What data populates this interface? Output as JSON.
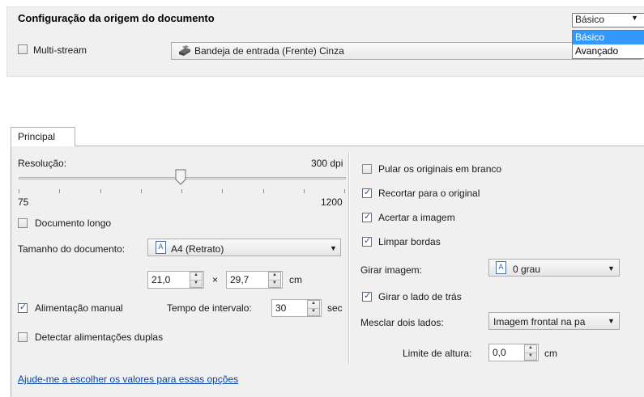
{
  "source": {
    "title": "Configuração da origem do documento",
    "multistream_label": "Multi-stream",
    "multistream_checked": false,
    "source_value": "Bandeja de entrada (Frente) Cinza",
    "mode_selected": "Básico",
    "mode_options": [
      "Básico",
      "Avançado"
    ]
  },
  "tabs": [
    {
      "label": "Principal"
    }
  ],
  "left": {
    "resolution_label": "Resolução:",
    "resolution_value": "300 dpi",
    "slider_min": "75",
    "slider_max": "1200",
    "long_doc_label": "Documento longo",
    "long_doc_checked": false,
    "doc_size_label": "Tamanho do documento:",
    "doc_size_value": "A4 (Retrato)",
    "width_value": "21,0",
    "times_symbol": "×",
    "height_value": "29,7",
    "unit_cm": "cm",
    "manual_feed_label": "Alimentação manual",
    "manual_feed_checked": true,
    "interval_label": "Tempo de intervalo:",
    "interval_value": "30",
    "interval_unit": "sec",
    "double_feed_label": "Detectar alimentações duplas",
    "double_feed_checked": false
  },
  "right": {
    "skip_blank_label": "Pular os originais em branco",
    "skip_blank_checked": false,
    "crop_label": "Recortar para o original",
    "crop_checked": true,
    "straighten_label": "Acertar a imagem",
    "straighten_checked": true,
    "clean_edges_label": "Limpar bordas",
    "clean_edges_checked": true,
    "rotate_label": "Girar imagem:",
    "rotate_value": "0 grau",
    "rotate_back_label": "Girar o lado de trás",
    "rotate_back_checked": true,
    "merge_label": "Mesclar dois lados:",
    "merge_value": "Imagem frontal na pa",
    "height_limit_label": "Limite de altura:",
    "height_limit_value": "0,0",
    "height_limit_unit": "cm"
  },
  "help_link": "Ajude-me a escolher os valores para essas opções"
}
